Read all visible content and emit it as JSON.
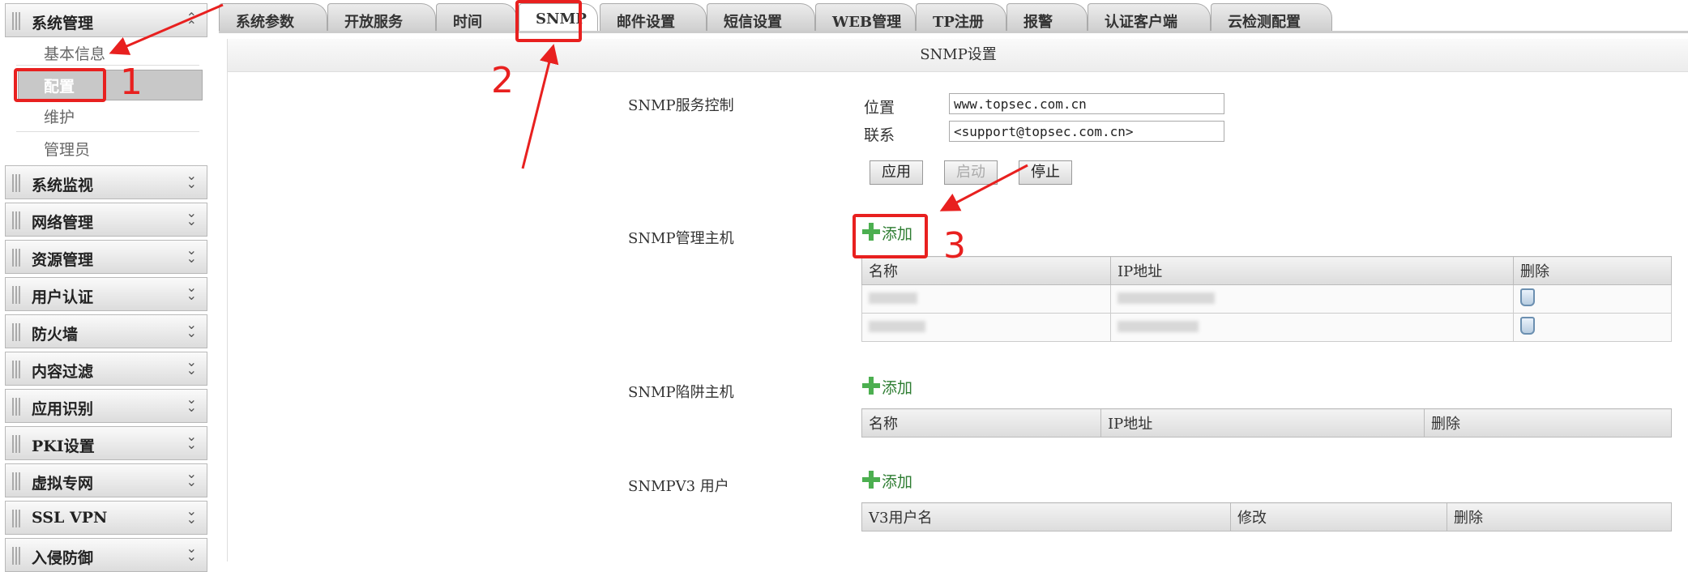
{
  "sidebar": {
    "top_group": "系统管理",
    "sub_items": [
      "基本信息",
      "配置",
      "维护",
      "管理员"
    ],
    "groups": [
      "系统监视",
      "网络管理",
      "资源管理",
      "用户认证",
      "防火墙",
      "内容过滤",
      "应用识别",
      "PKI设置",
      "虚拟专网",
      "SSL VPN",
      "入侵防御"
    ]
  },
  "tabs": [
    "系统参数",
    "开放服务",
    "时间",
    "SNMP",
    "邮件设置",
    "短信设置",
    "WEB管理",
    "TP注册",
    "报警",
    "认证客户端",
    "云检测配置"
  ],
  "active_tab": "SNMP",
  "main": {
    "title": "SNMP设置",
    "service": {
      "label": "SNMP服务控制",
      "location_label": "位置",
      "location_value": "www.topsec.com.cn",
      "contact_label": "联系",
      "contact_value": "<support@topsec.com.cn>",
      "apply": "应用",
      "start": "启动",
      "stop": "停止"
    },
    "mgmt_hosts": {
      "label": "SNMP管理主机",
      "add": "添加",
      "columns": [
        "名称",
        "IP地址",
        "删除"
      ]
    },
    "trap_hosts": {
      "label": "SNMP陷阱主机",
      "add": "添加",
      "columns": [
        "名称",
        "IP地址",
        "删除"
      ]
    },
    "v3_users": {
      "label": "SNMPV3 用户",
      "add": "添加",
      "columns": [
        "V3用户名",
        "修改",
        "删除"
      ]
    }
  },
  "annotations": {
    "n1": "1",
    "n2": "2",
    "n3": "3",
    "color": "#e8201f"
  }
}
